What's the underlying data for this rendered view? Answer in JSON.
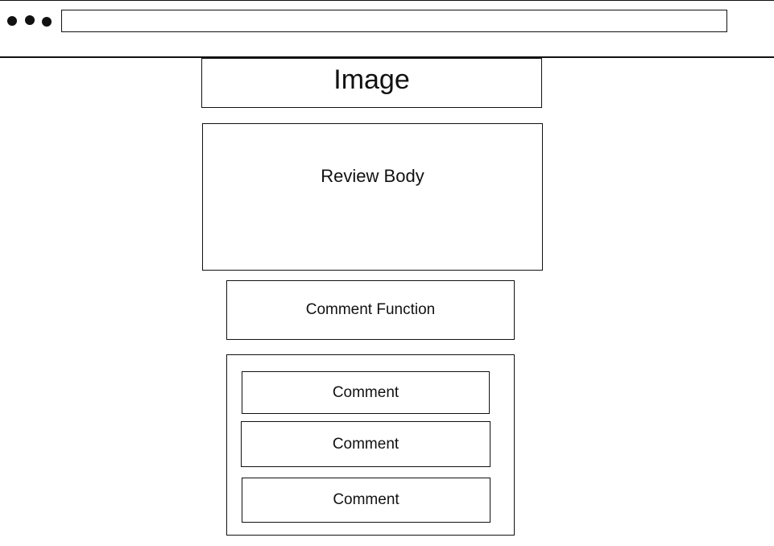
{
  "header": {
    "window_controls": [
      "dot",
      "dot",
      "dot"
    ],
    "url_bar": ""
  },
  "main": {
    "image_label": "Image",
    "review_body_label": "Review Body",
    "comment_function_label": "Comment Function",
    "comments": [
      {
        "label": "Comment"
      },
      {
        "label": "Comment"
      },
      {
        "label": "Comment"
      }
    ]
  }
}
